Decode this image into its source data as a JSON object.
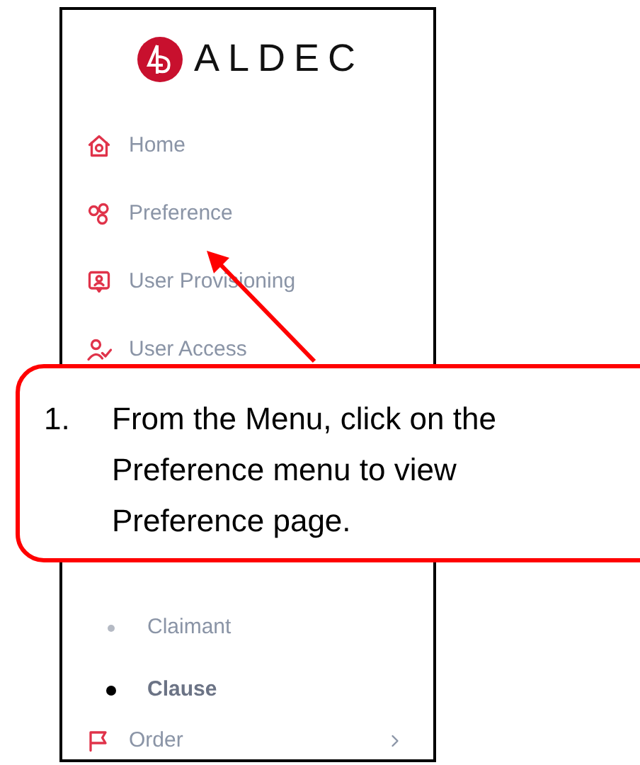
{
  "logo": {
    "text": "ALDEC"
  },
  "menu": [
    {
      "kind": "item",
      "label": "Home"
    },
    {
      "kind": "item",
      "label": "Preference"
    },
    {
      "kind": "item",
      "label": "User Provisioning"
    },
    {
      "kind": "item",
      "label": "User Access"
    },
    {
      "kind": "hidden"
    },
    {
      "kind": "subitem",
      "label": "Claimant",
      "selected": false
    },
    {
      "kind": "subitem",
      "label": "Clause",
      "selected": true
    },
    {
      "kind": "group",
      "label": "Order"
    }
  ],
  "callout": {
    "number": "1.",
    "text": "From the Menu, click on the Preference menu to view Preference page."
  }
}
